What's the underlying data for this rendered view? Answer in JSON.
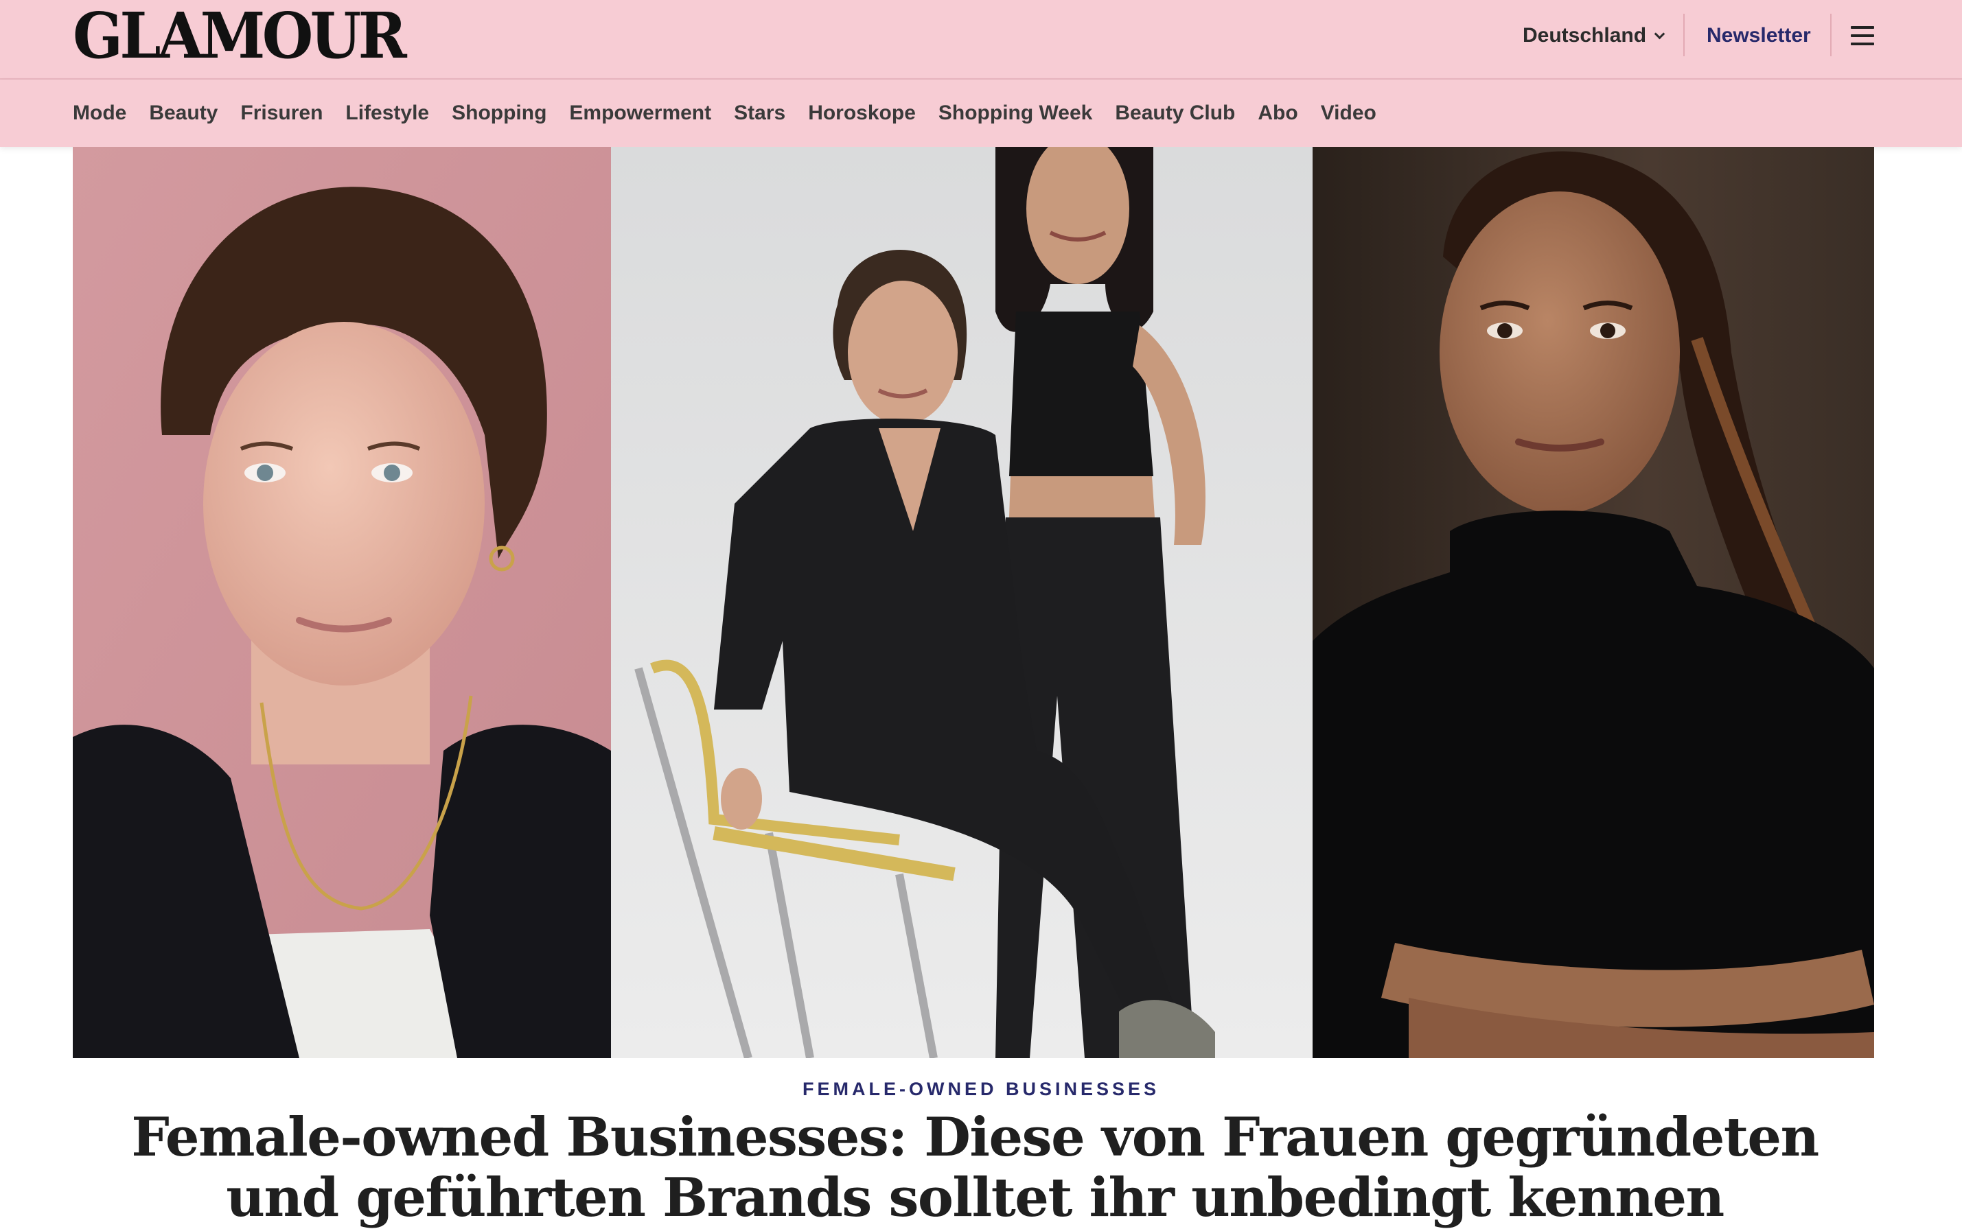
{
  "header": {
    "logo": "GLAMOUR",
    "region": "Deutschland",
    "newsletter": "Newsletter",
    "menu_icon": "hamburger-menu-icon",
    "chevron_icon": "chevron-down-icon"
  },
  "nav": {
    "items": [
      "Mode",
      "Beauty",
      "Frisuren",
      "Lifestyle",
      "Shopping",
      "Empowerment",
      "Stars",
      "Horoskope",
      "Shopping Week",
      "Beauty Club",
      "Abo",
      "Video"
    ]
  },
  "article": {
    "category": "FEMALE-OWNED BUSINESSES",
    "headline": "Female-owned Businesses: Diese von Frauen gegründeten und geführten Brands solltet ihr unbedingt kennen"
  },
  "colors": {
    "header_bg": "#f7ccd4",
    "accent": "#27296b",
    "text": "#1f1f1f"
  }
}
